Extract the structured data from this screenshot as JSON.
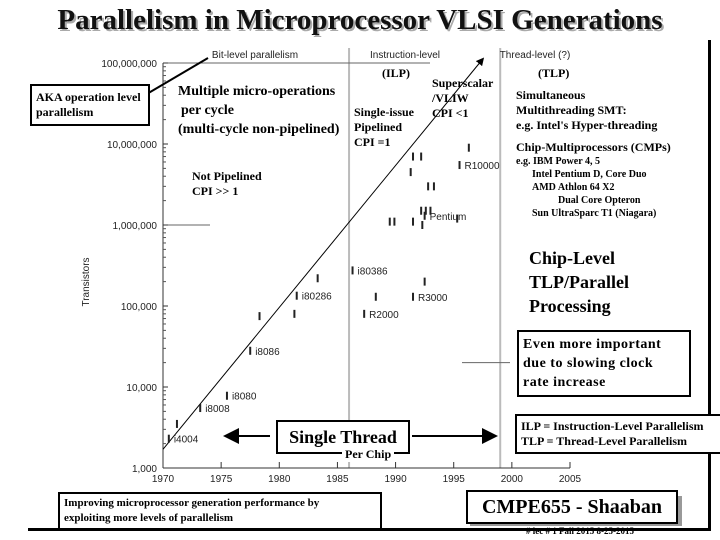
{
  "title": "Parallelism in Microprocessor VLSI Generations",
  "chart_data": {
    "type": "scatter",
    "xlabel": "",
    "ylabel": "Transistors",
    "xlim": [
      1970,
      2005
    ],
    "ylim": [
      1000,
      100000000
    ],
    "yscale": "log",
    "x_ticks": [
      "1970",
      "1975",
      "1980",
      "1985",
      "1990",
      "1995",
      "2000",
      "2005"
    ],
    "y_ticks": [
      "1,000",
      "10,000",
      "100,000",
      "1,000,000",
      "10,000,000",
      "100,000,000"
    ],
    "band_labels": [
      "Bit-level parallelism",
      "Instruction-level",
      "Thread-level (?)"
    ],
    "band_boundaries": [
      1986,
      1999
    ],
    "trend": {
      "x": [
        1970,
        1997.5
      ],
      "y": [
        1700,
        100000000
      ]
    },
    "points": [
      {
        "label": "i4004",
        "x": 1970.5,
        "y": 2300
      },
      {
        "label": "",
        "x": 1971.2,
        "y": 3500
      },
      {
        "label": "i8008",
        "x": 1973.2,
        "y": 5500
      },
      {
        "label": "i8080",
        "x": 1975.5,
        "y": 7800
      },
      {
        "label": "i8086",
        "x": 1977.5,
        "y": 28000
      },
      {
        "label": "",
        "x": 1978.3,
        "y": 75000
      },
      {
        "label": "i80286",
        "x": 1981.5,
        "y": 134000
      },
      {
        "label": "",
        "x": 1981.3,
        "y": 80000
      },
      {
        "label": "",
        "x": 1983.3,
        "y": 220000
      },
      {
        "label": "i80386",
        "x": 1986.3,
        "y": 275000
      },
      {
        "label": "R2000",
        "x": 1987.3,
        "y": 80000
      },
      {
        "label": "",
        "x": 1988.3,
        "y": 130000
      },
      {
        "label": "R3000",
        "x": 1991.5,
        "y": 130000
      },
      {
        "label": "",
        "x": 1992.5,
        "y": 200000
      },
      {
        "label": "Pentium",
        "x": 1992.5,
        "y": 1300000
      },
      {
        "label": "",
        "x": 1992.3,
        "y": 1000000
      },
      {
        "label": "",
        "x": 1989.5,
        "y": 1100000
      },
      {
        "label": "",
        "x": 1989.9,
        "y": 1100000
      },
      {
        "label": "",
        "x": 1991.5,
        "y": 1100000
      },
      {
        "label": "",
        "x": 1992.2,
        "y": 1500000
      },
      {
        "label": "",
        "x": 1992.6,
        "y": 1500000
      },
      {
        "label": "",
        "x": 1993.0,
        "y": 1500000
      },
      {
        "label": "",
        "x": 1995.3,
        "y": 1200000
      },
      {
        "label": "",
        "x": 1992.8,
        "y": 3000000
      },
      {
        "label": "",
        "x": 1993.3,
        "y": 3000000
      },
      {
        "label": "",
        "x": 1991.5,
        "y": 7000000
      },
      {
        "label": "",
        "x": 1992.2,
        "y": 7000000
      },
      {
        "label": "",
        "x": 1991.3,
        "y": 4500000
      },
      {
        "label": "R10000",
        "x": 1995.5,
        "y": 5500000
      },
      {
        "label": "",
        "x": 1996.3,
        "y": 9000000
      }
    ]
  },
  "labels": {
    "aka": "AKA operation level parallelism",
    "multi1": "Multiple micro-operations",
    "multi2": "per cycle",
    "multi3": "(multi-cycle non-pipelined)",
    "notpipe1": "Not Pipelined",
    "notpipe2": "CPI >> 1",
    "ilp": "(ILP)",
    "single1": "Single-issue",
    "single2": "Pipelined",
    "single3": "CPI =1",
    "super1": "Superscalar",
    "super2": "/VLIW",
    "super3": "CPI <1",
    "tlp": "(TLP)",
    "smt1": "Simultaneous",
    "smt2": "Multithreading SMT:",
    "smt3": "e.g. Intel's Hyper-threading",
    "cmp1": "Chip-Multiprocessors (CMPs)",
    "cmp2": "e.g. IBM Power 4, 5",
    "cmp3": "Intel Pentium D, Core Duo",
    "cmp4": "AMD Athlon 64 X2",
    "cmp5": "Dual Core Opteron",
    "cmp6": "Sun UltraSparc T1 (Niagara)",
    "chip1": "Chip-Level",
    "chip2": "TLP/Parallel",
    "chip3": "Processing",
    "even1": "Even more important",
    "even2": "due to slowing clock",
    "even3": "rate increase",
    "single_thread": "Single Thread",
    "per_chip": "Per Chip",
    "def1": "ILP = Instruction-Level Parallelism",
    "def2": "TLP = Thread-Level Parallelism",
    "improve1": "Improving microprocessor generation performance by",
    "improve2": "exploiting  more levels of parallelism",
    "course": "CMPE655 - Shaaban",
    "footer": "#  lec # 1   Fall 2015   8-25-2015"
  }
}
